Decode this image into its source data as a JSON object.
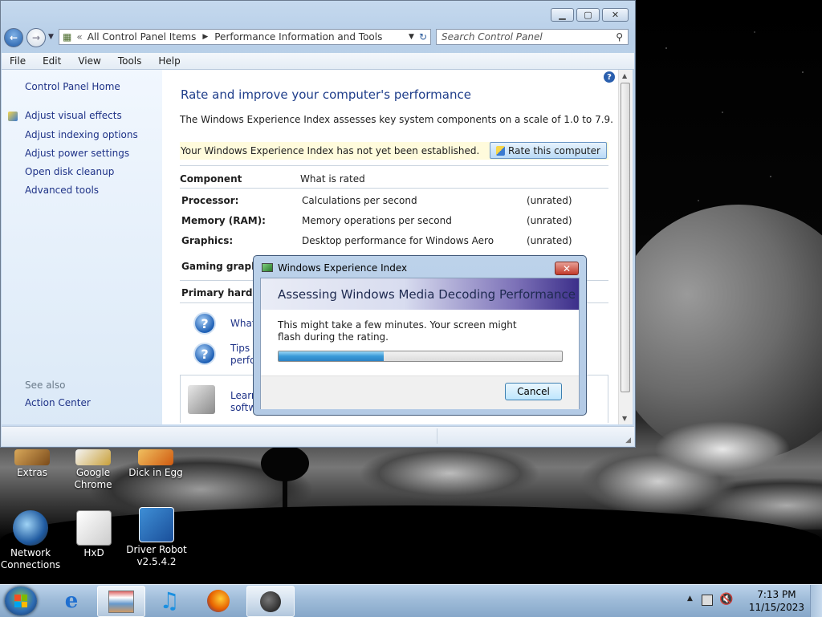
{
  "desktop": {
    "icons": [
      {
        "label": "Extras"
      },
      {
        "label": "Google Chrome"
      },
      {
        "label": "Dick in Egg"
      },
      {
        "label": "Network Connections"
      },
      {
        "label": "HxD"
      },
      {
        "label": "Driver Robot v2.5.4.2"
      }
    ]
  },
  "window": {
    "address": {
      "segments": [
        "All Control Panel Items",
        "Performance Information and Tools"
      ]
    },
    "search": {
      "placeholder": "Search Control Panel"
    },
    "menu": [
      "File",
      "Edit",
      "View",
      "Tools",
      "Help"
    ],
    "left_pane": {
      "home": "Control Panel Home",
      "links": [
        "Adjust visual effects",
        "Adjust indexing options",
        "Adjust power settings",
        "Open disk cleanup",
        "Advanced tools"
      ],
      "see_also_heading": "See also",
      "see_also_links": [
        "Action Center"
      ]
    },
    "main": {
      "heading": "Rate and improve your computer's performance",
      "description": "The Windows Experience Index assesses key system components on a scale of 1.0 to 7.9.",
      "banner_text": "Your Windows Experience Index has not yet been established.",
      "rate_button": "Rate this computer",
      "table_headers": {
        "component": "Component",
        "what_is_rated": "What is rated"
      },
      "rows": [
        {
          "component": "Processor:",
          "rated": "Calculations per second",
          "score": "(unrated)"
        },
        {
          "component": "Memory (RAM):",
          "rated": "Memory operations per second",
          "score": "(unrated)"
        },
        {
          "component": "Graphics:",
          "rated": "Desktop performance for Windows Aero",
          "score": "(unrated)"
        },
        {
          "component": "Gaming graphics"
        },
        {
          "component": "Primary hard dis"
        }
      ],
      "help_links": [
        "What",
        "Tips f",
        "perfo"
      ],
      "learn_links": [
        "Learn",
        "softw"
      ]
    }
  },
  "dialog": {
    "title": "Windows Experience Index",
    "heading": "Assessing Windows Media Decoding Performance",
    "message": "This might take a few minutes. Your screen might flash during the rating.",
    "progress": 0.37,
    "cancel_label": "Cancel"
  },
  "taskbar": {
    "time": "7:13 PM",
    "date": "11/15/2023"
  }
}
